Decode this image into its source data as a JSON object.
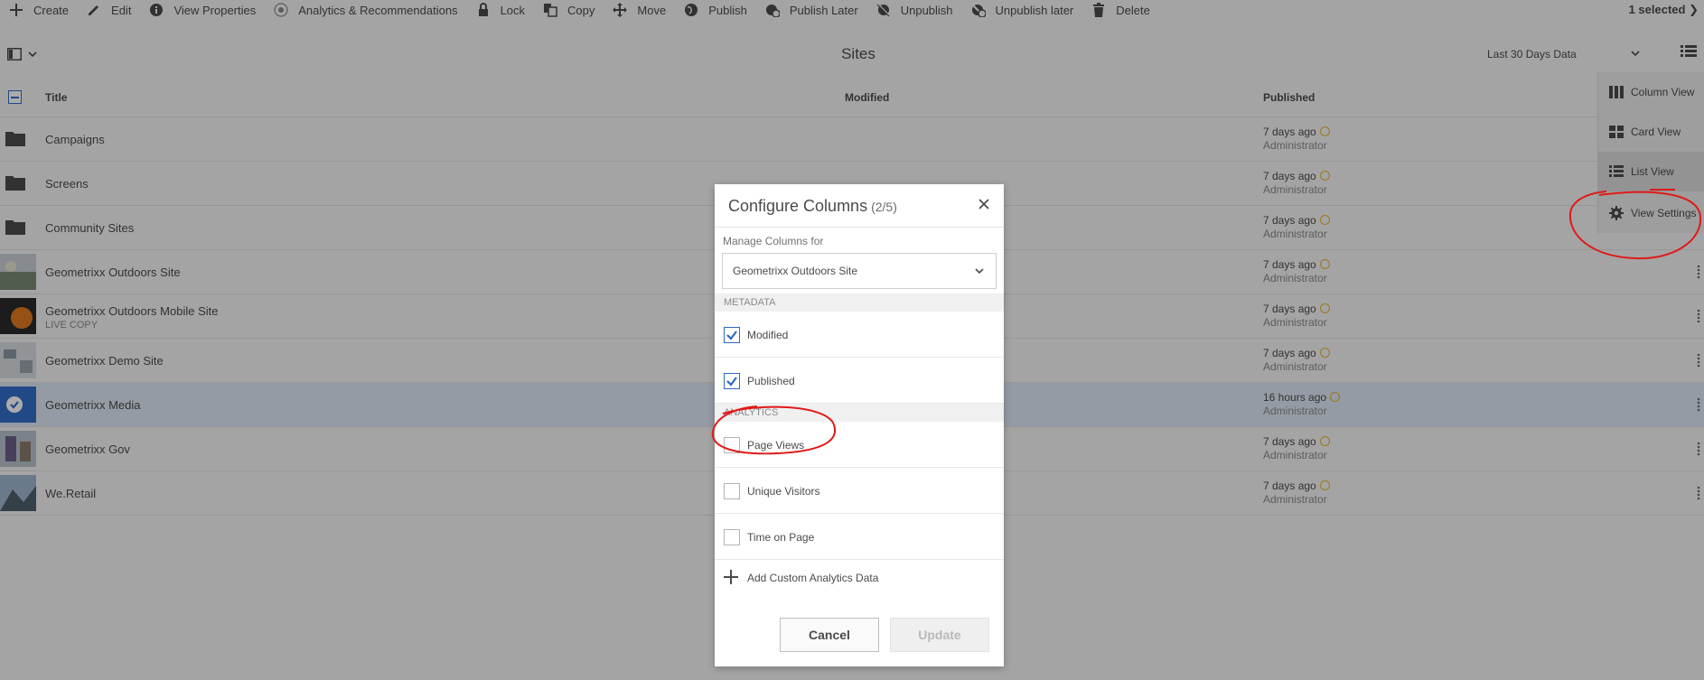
{
  "actionbar": {
    "items": [
      {
        "label": "Create",
        "icon": "plus-icon"
      },
      {
        "label": "Edit",
        "icon": "pencil-icon"
      },
      {
        "label": "View Properties",
        "icon": "info-icon"
      },
      {
        "label": "Analytics & Recommendations",
        "icon": "analytics-icon"
      },
      {
        "label": "Lock",
        "icon": "lock-icon"
      },
      {
        "label": "Copy",
        "icon": "copy-icon"
      },
      {
        "label": "Move",
        "icon": "move-icon"
      },
      {
        "label": "Publish",
        "icon": "globe-icon"
      },
      {
        "label": "Publish Later",
        "icon": "globe-clock-icon"
      },
      {
        "label": "Unpublish",
        "icon": "globe-off-icon"
      },
      {
        "label": "Unpublish later",
        "icon": "globe-off-clock-icon"
      },
      {
        "label": "Delete",
        "icon": "trash-icon"
      }
    ],
    "selected_count": "1 selected"
  },
  "header": {
    "title": "Sites",
    "data_range": "Last 30 Days Data"
  },
  "table": {
    "columns": {
      "title": "Title",
      "modified": "Modified",
      "published": "Published"
    },
    "rows": [
      {
        "title": "Campaigns",
        "sub": "",
        "published": "7 days ago",
        "by": "Administrator",
        "kind": "folder"
      },
      {
        "title": "Screens",
        "sub": "",
        "published": "7 days ago",
        "by": "Administrator",
        "kind": "folder"
      },
      {
        "title": "Community Sites",
        "sub": "",
        "published": "7 days ago",
        "by": "Administrator",
        "kind": "folder"
      },
      {
        "title": "Geometrixx Outdoors Site",
        "sub": "",
        "published": "7 days ago",
        "by": "Administrator",
        "kind": "thumb"
      },
      {
        "title": "Geometrixx Outdoors Mobile Site",
        "sub": "LIVE COPY",
        "published": "7 days ago",
        "by": "Administrator",
        "kind": "thumb"
      },
      {
        "title": "Geometrixx Demo Site",
        "sub": "",
        "published": "7 days ago",
        "by": "Administrator",
        "kind": "thumb"
      },
      {
        "title": "Geometrixx Media",
        "sub": "",
        "published": "16 hours ago",
        "by": "Administrator",
        "kind": "selected"
      },
      {
        "title": "Geometrixx Gov",
        "sub": "",
        "published": "7 days ago",
        "by": "Administrator",
        "kind": "thumb"
      },
      {
        "title": "We.Retail",
        "sub": "",
        "published": "7 days ago",
        "by": "Administrator",
        "kind": "thumb"
      }
    ]
  },
  "view_menu": {
    "column_view": "Column View",
    "card_view": "Card View",
    "list_view": "List View",
    "view_settings": "View Settings"
  },
  "dialog": {
    "title": "Configure Columns",
    "count": "(2/5)",
    "manage_label": "Manage Columns for",
    "selected_site": "Geometrixx Outdoors Site",
    "metadata_header": "METADATA",
    "analytics_header": "ANALYTICS",
    "options": {
      "modified": {
        "label": "Modified",
        "checked": true
      },
      "published": {
        "label": "Published",
        "checked": true
      },
      "page_views": {
        "label": "Page Views",
        "checked": false
      },
      "unique_visitors": {
        "label": "Unique Visitors",
        "checked": false
      },
      "time_on_page": {
        "label": "Time on Page",
        "checked": false
      }
    },
    "add_custom": "Add Custom Analytics Data",
    "cancel": "Cancel",
    "update": "Update"
  },
  "colors": {
    "accent": "#2d68c4",
    "annotation": "#e01a1a",
    "clock": "#e6b52a"
  }
}
